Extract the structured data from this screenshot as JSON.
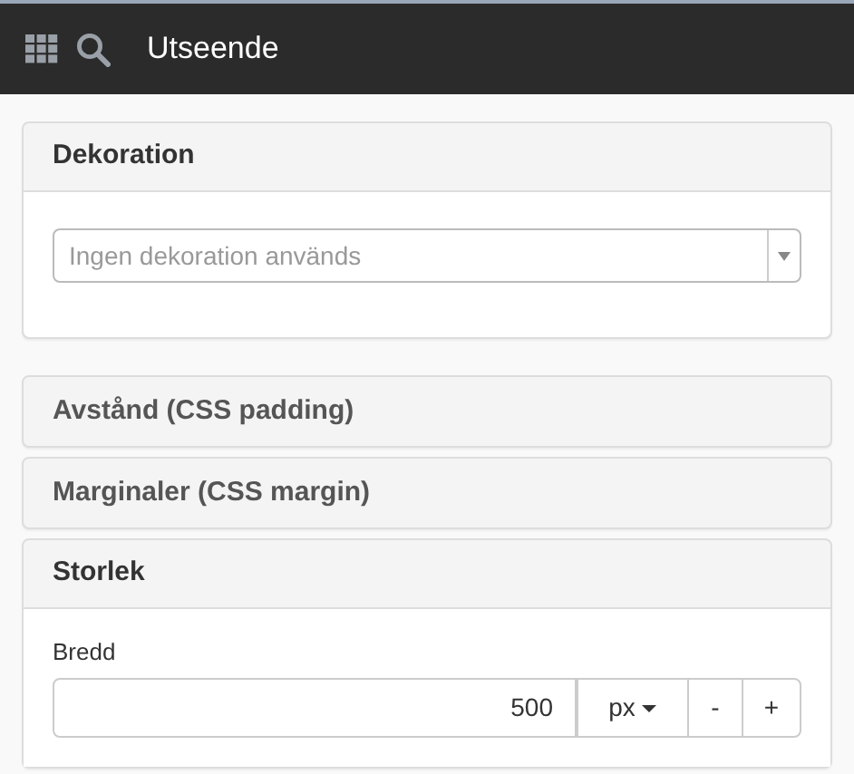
{
  "header": {
    "title": "Utseende"
  },
  "panels": [
    {
      "title": "Dekoration",
      "expanded": true,
      "kind": "select",
      "placeholder": "Ingen dekoration används"
    },
    {
      "title": "Avstånd (CSS padding)",
      "expanded": false
    },
    {
      "title": "Marginaler (CSS margin)",
      "expanded": false
    },
    {
      "title": "Storlek",
      "expanded": true,
      "kind": "size",
      "label": "Bredd",
      "value": "500",
      "unit": "px",
      "minus": "-",
      "plus": "+"
    }
  ]
}
